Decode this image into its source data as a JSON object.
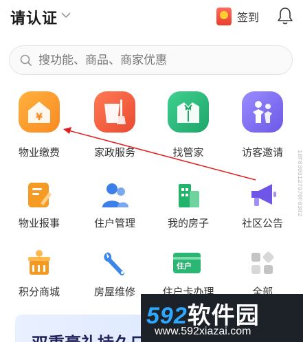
{
  "header": {
    "title": "请认证",
    "checkin_label": "签到"
  },
  "search": {
    "placeholder": "搜功能、商品、商家优惠"
  },
  "grid": {
    "items": [
      {
        "label": "物业缴费",
        "icon": "property-fee-icon",
        "color": "#fb9a2d"
      },
      {
        "label": "家政服务",
        "icon": "housekeeping-icon",
        "color": "#f15b3d"
      },
      {
        "label": "找管家",
        "icon": "butler-icon",
        "color": "#27b87a"
      },
      {
        "label": "访客邀请",
        "icon": "visitor-icon",
        "color": "#7b6cf0"
      },
      {
        "label": "物业报事",
        "icon": "report-icon",
        "color": "#f59a23"
      },
      {
        "label": "住户管理",
        "icon": "resident-icon",
        "color": "#3d7fe8"
      },
      {
        "label": "我的房子",
        "icon": "house-icon",
        "color": "#24b36b"
      },
      {
        "label": "社区公告",
        "icon": "megaphone-icon",
        "color": "#6f56e8"
      },
      {
        "label": "积分商城",
        "icon": "points-mall-icon",
        "color": "#f39a22"
      },
      {
        "label": "房屋维修",
        "icon": "wrench-icon",
        "color": "#3c86ea"
      },
      {
        "label": "住户卡办理",
        "icon": "resident-card-icon",
        "color": "#2bb673",
        "card_text": "住户"
      },
      {
        "label": "全部",
        "icon": "all-apps-icon",
        "color": "#bdbdbd"
      }
    ]
  },
  "banner": {
    "text": "双重豪礼持久口"
  },
  "watermark": {
    "brand_num": "592",
    "brand_text": "软件园",
    "url": "www.592xiazai.com"
  },
  "side_code": "10F0303127970F0302"
}
